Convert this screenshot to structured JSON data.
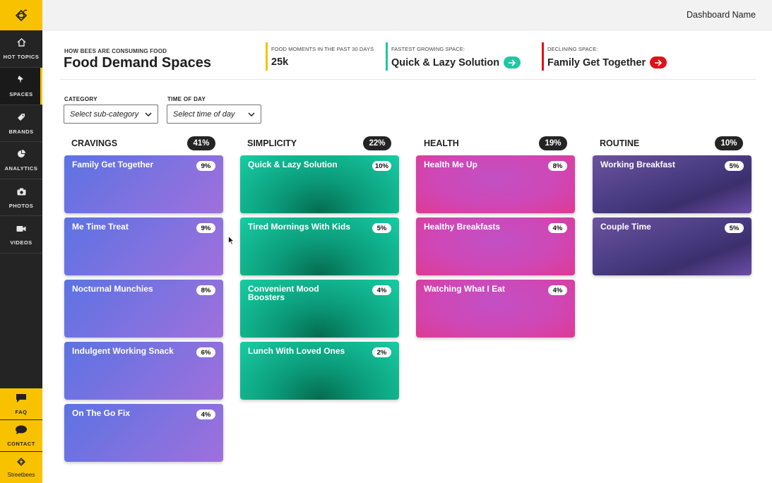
{
  "colors": {
    "brand_yellow": "#f8c200",
    "sidebar_bg": "#242424",
    "growing_accent": "#1ec8a0",
    "declining_accent": "#e0101a",
    "food_moments_accent": "#f8c200"
  },
  "sidebar": {
    "logo_icon": "bee-logo-icon",
    "items": [
      {
        "label": "HOT TOPICS",
        "icon": "home-icon"
      },
      {
        "label": "SPACES",
        "icon": "pin-icon"
      },
      {
        "label": "BRANDS",
        "icon": "tag-icon"
      },
      {
        "label": "ANALYTICS",
        "icon": "pie-chart-icon"
      },
      {
        "label": "PHOTOS",
        "icon": "camera-icon"
      },
      {
        "label": "VIDEOS",
        "icon": "video-icon"
      }
    ],
    "faq": "FAQ",
    "contact": "CONTACT",
    "brand": "Streetbees"
  },
  "topbar": {
    "dashboard_name": "Dashboard Name"
  },
  "header": {
    "eyebrow": "HOW BEES ARE CONSUMING FOOD",
    "title": "Food Demand Spaces",
    "stats": [
      {
        "caption": "FOOD MOMENTS IN THE PAST 30 DAYS",
        "value": "25k"
      },
      {
        "caption": "FASTEST GROWING SPACE:",
        "value": "Quick & Lazy Solution"
      },
      {
        "caption": "DECLINING SPACE:",
        "value": "Family Get Together"
      }
    ]
  },
  "filters": {
    "category": {
      "label": "CATEGORY",
      "value": "Select sub-category"
    },
    "time_of_day": {
      "label": "TIME OF DAY",
      "value": "Select time of day"
    }
  },
  "columns": [
    {
      "title": "CRAVINGS",
      "pct": "41%",
      "cards": [
        {
          "name": "Family Get Together",
          "pct": "9%"
        },
        {
          "name": "Me Time Treat",
          "pct": "9%"
        },
        {
          "name": "Nocturnal Munchies",
          "pct": "8%"
        },
        {
          "name": "Indulgent Working Snack",
          "pct": "6%"
        },
        {
          "name": "On The Go Fix",
          "pct": "4%"
        }
      ]
    },
    {
      "title": "SIMPLICITY",
      "pct": "22%",
      "cards": [
        {
          "name": "Quick & Lazy Solution",
          "pct": "10%"
        },
        {
          "name": "Tired Mornings With Kids",
          "pct": "5%"
        },
        {
          "name": "Convenient Mood Boosters",
          "pct": "4%"
        },
        {
          "name": "Lunch With Loved Ones",
          "pct": "2%"
        }
      ]
    },
    {
      "title": "HEALTH",
      "pct": "19%",
      "cards": [
        {
          "name": "Health Me Up",
          "pct": "8%"
        },
        {
          "name": "Healthy Breakfasts",
          "pct": "4%"
        },
        {
          "name": "Watching What I Eat",
          "pct": "4%"
        }
      ]
    },
    {
      "title": "ROUTINE",
      "pct": "10%",
      "cards": [
        {
          "name": "Working Breakfast",
          "pct": "5%"
        },
        {
          "name": "Couple Time",
          "pct": "5%"
        }
      ]
    }
  ]
}
